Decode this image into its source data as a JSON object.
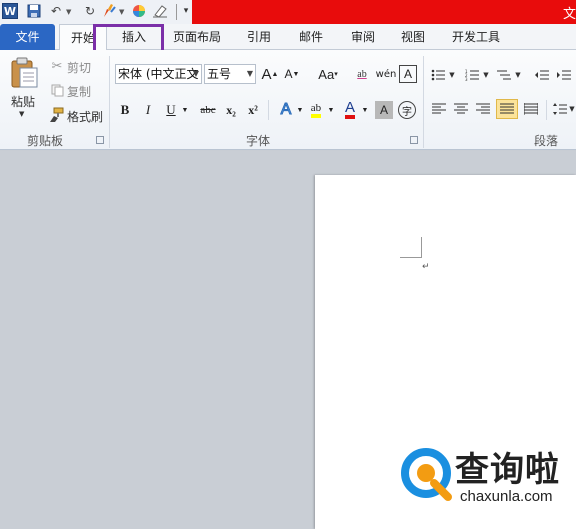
{
  "app": {
    "logo_letter": "W",
    "window_title": "文"
  },
  "quick_access": {
    "icons": [
      "word-logo-icon",
      "save-icon",
      "undo-icon",
      "redo-icon",
      "format-brush-icon",
      "color-wheel-icon",
      "eraser-icon",
      "customize-icon"
    ]
  },
  "tabs": {
    "file": "文件",
    "home": "开始",
    "insert": "插入",
    "page_layout": "页面布局",
    "references": "引用",
    "mailings": "邮件",
    "review": "审阅",
    "view": "视图",
    "developer": "开发工具"
  },
  "clipboard": {
    "paste": "粘贴",
    "cut": "剪切",
    "copy": "复制",
    "format_painter": "格式刷",
    "group_label": "剪贴板"
  },
  "font": {
    "font_name": "宋体 (中文正文",
    "font_size": "五号",
    "grow": "A",
    "shrink": "A",
    "change_case": "Aa",
    "clear_format": "ab",
    "phonetic": "wén",
    "char_border": "A",
    "bold": "B",
    "italic": "I",
    "underline": "U",
    "strikethrough": "abc",
    "subscript": "x₂",
    "superscript": "x²",
    "text_effect": "A",
    "highlight": "ab",
    "font_color": "A",
    "char_shading": "A",
    "enclose": "字",
    "group_label": "字体"
  },
  "paragraph": {
    "group_label": "段落"
  },
  "watermark": {
    "title": "查询啦",
    "subtitle": "chaxunla.com"
  },
  "colors": {
    "file_tab": "#2b67c4",
    "title_bar": "#e80c0c",
    "highlight_box": "#7b2fa8",
    "watermark_blue": "#1a8fe0",
    "watermark_orange": "#f39c12"
  }
}
